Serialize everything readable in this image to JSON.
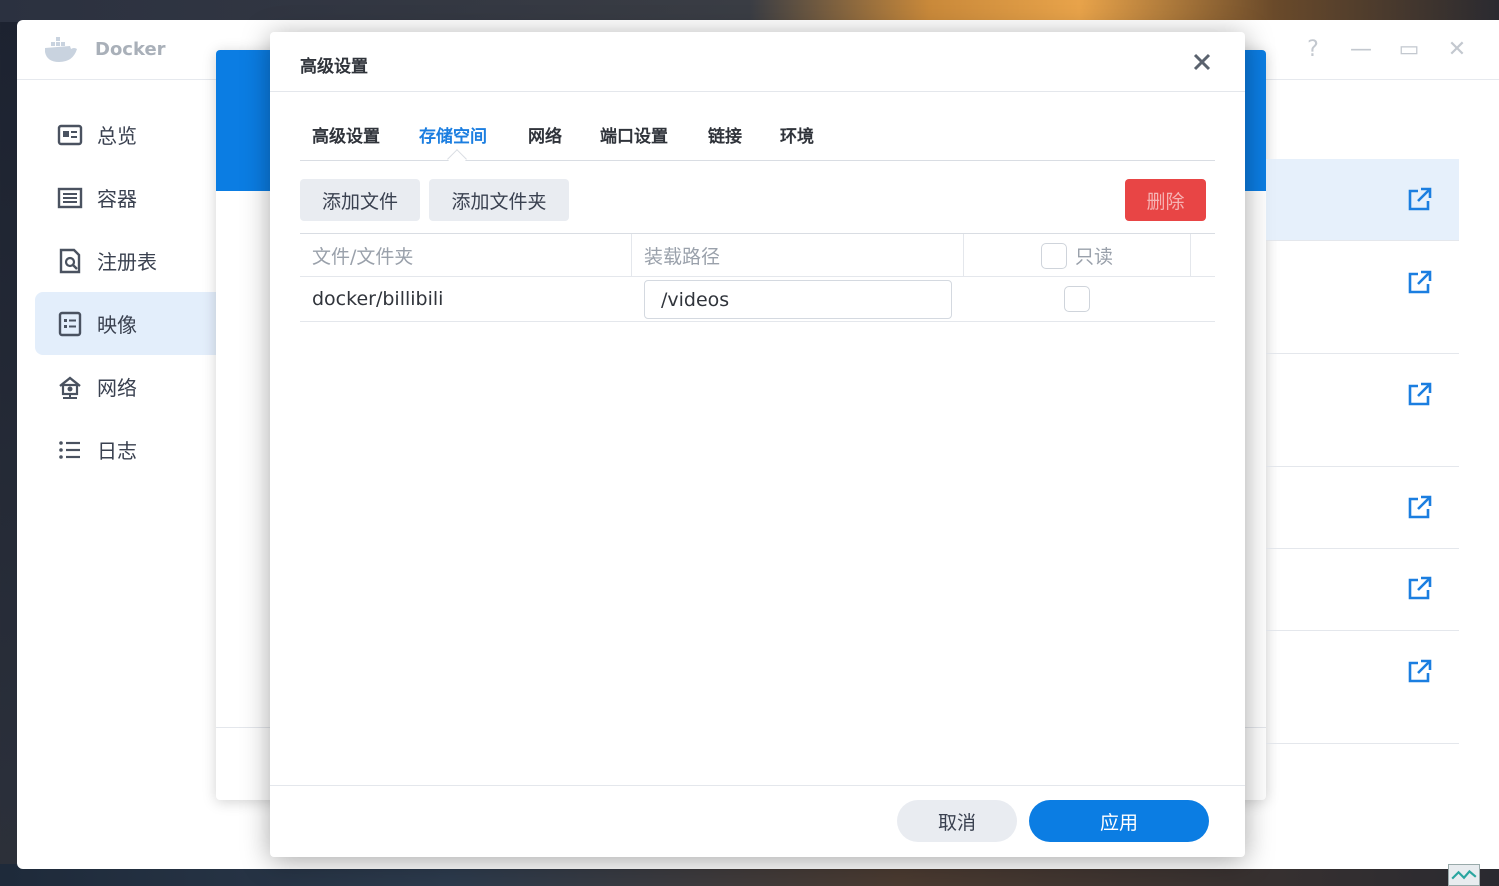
{
  "app": {
    "title": "Docker",
    "window_controls": [
      "?",
      "—",
      "▭",
      "✕"
    ]
  },
  "sidebar": {
    "items": [
      {
        "label": "总览",
        "icon": "overview-icon",
        "active": false
      },
      {
        "label": "容器",
        "icon": "container-icon",
        "active": false
      },
      {
        "label": "注册表",
        "icon": "registry-icon",
        "active": false
      },
      {
        "label": "映像",
        "icon": "image-icon",
        "active": true
      },
      {
        "label": "网络",
        "icon": "network-icon",
        "active": false
      },
      {
        "label": "日志",
        "icon": "log-icon",
        "active": false
      }
    ]
  },
  "dialog": {
    "title": "高级设置",
    "tabs": [
      {
        "label": "高级设置",
        "active": false
      },
      {
        "label": "存储空间",
        "active": true
      },
      {
        "label": "网络",
        "active": false
      },
      {
        "label": "端口设置",
        "active": false
      },
      {
        "label": "链接",
        "active": false
      },
      {
        "label": "环境",
        "active": false
      }
    ],
    "toolbar": {
      "add_file_label": "添加文件",
      "add_folder_label": "添加文件夹",
      "delete_label": "删除"
    },
    "table": {
      "columns": [
        "文件/文件夹",
        "装载路径",
        "只读"
      ],
      "rows": [
        {
          "file": "docker/billibili",
          "mount_path": "/videos",
          "readonly": false
        }
      ]
    },
    "footer": {
      "cancel_label": "取消",
      "apply_label": "应用"
    }
  },
  "colors": {
    "accent": "#0b7de3",
    "danger": "#e84545",
    "active_tab": "#1b7ee0",
    "sidebar_active_bg": "#e3eefb"
  }
}
